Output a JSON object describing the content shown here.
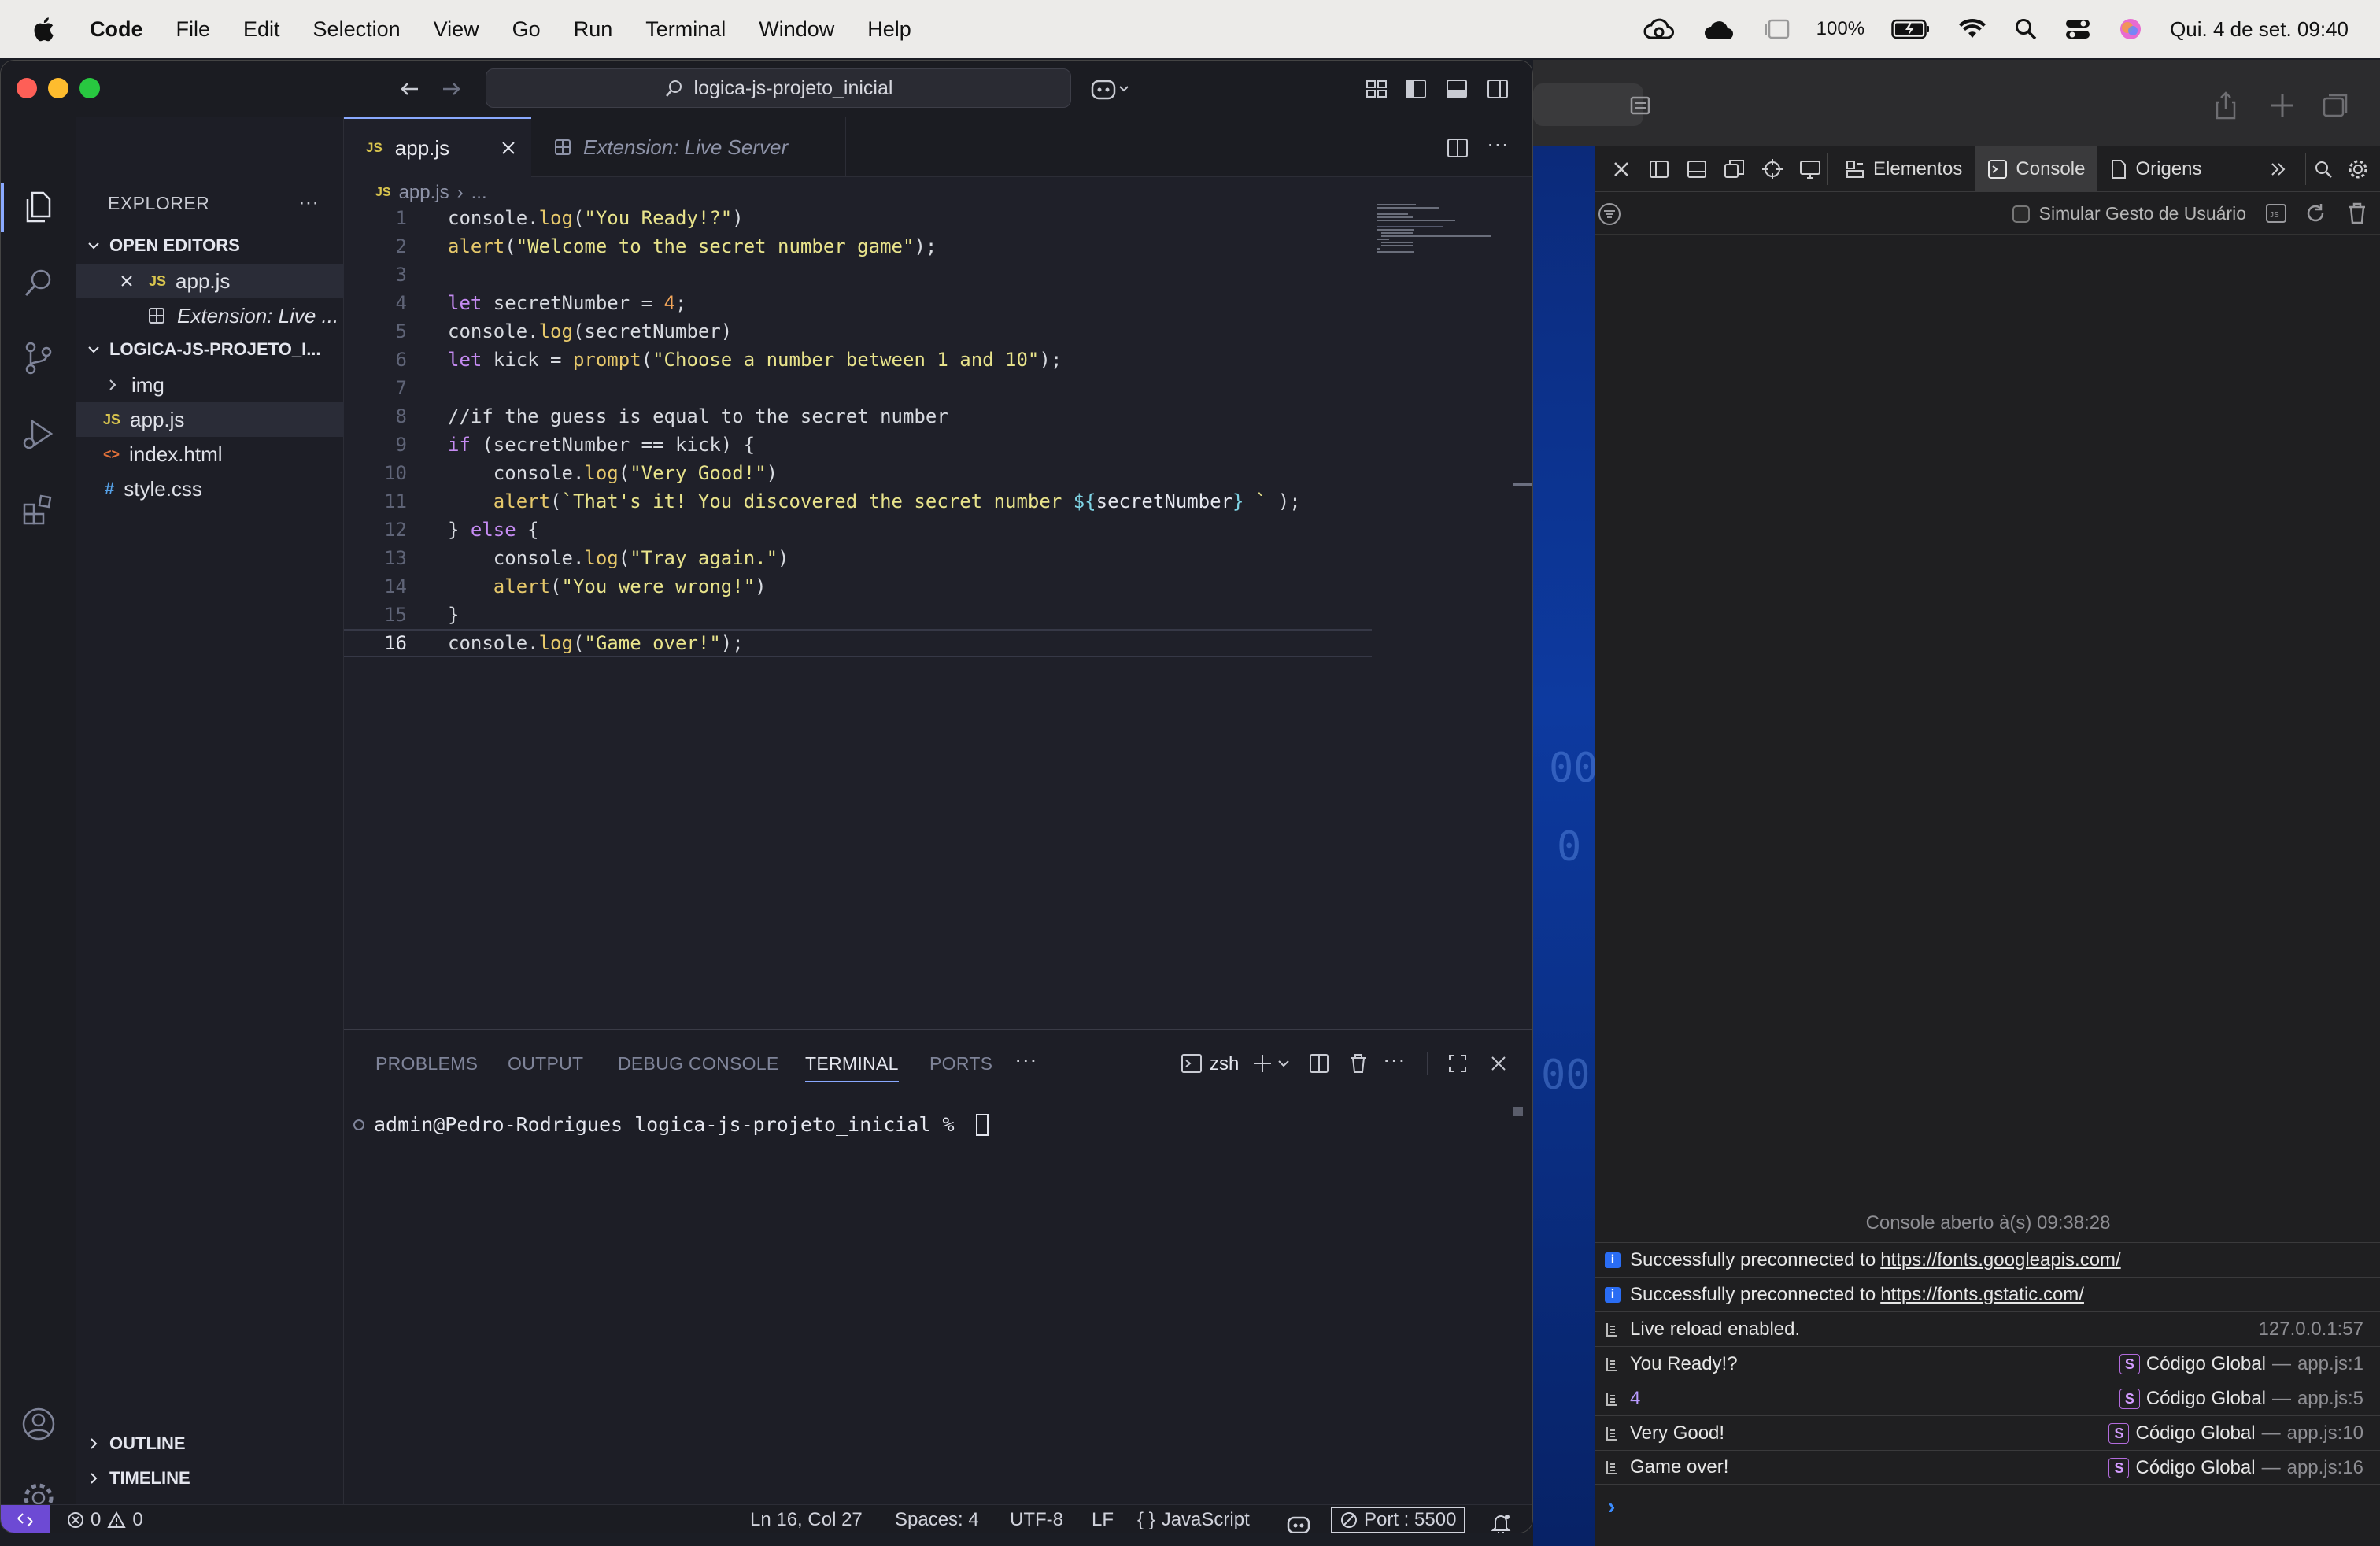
{
  "menubar": {
    "app": "Code",
    "items": [
      "File",
      "Edit",
      "Selection",
      "View",
      "Go",
      "Run",
      "Terminal",
      "Window",
      "Help"
    ],
    "battery": "100%",
    "datetime": "Qui. 4 de set.  09:40"
  },
  "titlebar": {
    "command_center": "logica-js-projeto_inicial"
  },
  "explorer": {
    "title": "EXPLORER",
    "open_editors_label": "OPEN EDITORS",
    "open_editors": [
      {
        "name": "app.js",
        "icon": "JS"
      },
      {
        "name": "Extension: Live ...",
        "icon": "extension-icon"
      }
    ],
    "project_label": "LOGICA-JS-PROJETO_I...",
    "files": [
      {
        "name": "img",
        "type": "folder"
      },
      {
        "name": "app.js",
        "type": "js",
        "icon": "JS"
      },
      {
        "name": "index.html",
        "type": "html",
        "icon": "<>"
      },
      {
        "name": "style.css",
        "type": "css",
        "icon": "#"
      }
    ],
    "outline_label": "OUTLINE",
    "timeline_label": "TIMELINE"
  },
  "tabs": [
    {
      "label": "app.js",
      "icon": "JS",
      "active": true
    },
    {
      "label": "Extension: Live Server",
      "active": false
    }
  ],
  "breadcrumb": {
    "file": "app.js",
    "rest": "..."
  },
  "code_lines": [
    "console.log(\"You Ready!?\")",
    "alert(\"Welcome to the secret number game\");",
    "",
    "let secretNumber = 4;",
    "console.log(secretNumber)",
    "let kick = prompt(\"Choose a number between 1 and 10\");",
    "",
    "//if the guess is equal to the secret number",
    "if (secretNumber == kick) {",
    "    console.log(\"Very Good!\")",
    "    alert(`That's it! You discovered the secret number ${secretNumber} ` );",
    "} else {",
    "    console.log(\"Tray again.\")",
    "    alert(\"You were wrong!\")",
    "}",
    "console.log(\"Game over!\");"
  ],
  "line_numbers": [
    "1",
    "2",
    "3",
    "4",
    "5",
    "6",
    "7",
    "8",
    "9",
    "10",
    "11",
    "12",
    "13",
    "14",
    "15",
    "16"
  ],
  "panel": {
    "tabs": [
      "PROBLEMS",
      "OUTPUT",
      "DEBUG CONSOLE",
      "TERMINAL",
      "PORTS"
    ],
    "active_tab": "TERMINAL",
    "shell": "zsh",
    "prompt": "admin@Pedro-Rodrigues logica-js-projeto_inicial % "
  },
  "statusbar": {
    "errors": "0",
    "warnings": "0",
    "position": "Ln 16, Col 27",
    "spaces": "Spaces: 4",
    "encoding": "UTF-8",
    "eol": "LF",
    "language": "JavaScript",
    "port": "Port : 5500"
  },
  "devtools": {
    "tabs": [
      "Elementos",
      "Console",
      "Origens"
    ],
    "active_tab": "Console",
    "simulate_gesture": "Simular Gesto de Usuário",
    "console_opened": "Console aberto à(s) 09:38:28",
    "messages": [
      {
        "type": "info",
        "text": "Successfully preconnected to",
        "link": "https://fonts.googleapis.com/"
      },
      {
        "type": "info",
        "text": "Successfully preconnected to",
        "link": "https://fonts.gstatic.com/"
      },
      {
        "type": "log",
        "text": "Live reload enabled.",
        "source": "127.0.0.1:57"
      },
      {
        "type": "log",
        "text": "You Ready!?",
        "scope": "Código Global",
        "source": "app.js:1"
      },
      {
        "type": "log",
        "text": "4",
        "scope": "Código Global",
        "source": "app.js:5"
      },
      {
        "type": "log",
        "text": "Very Good!",
        "scope": "Código Global",
        "source": "app.js:10"
      },
      {
        "type": "log",
        "text": "Game over!",
        "scope": "Código Global",
        "source": "app.js:16"
      }
    ]
  }
}
